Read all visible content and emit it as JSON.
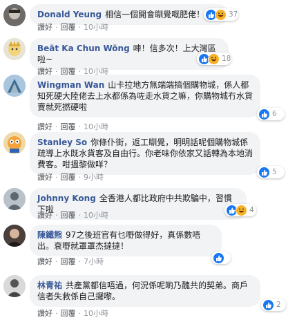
{
  "comments": [
    {
      "author": "Donald Yeung",
      "text": "相信一個開會瞓覺嘅肥佬！",
      "reactions": [
        "like",
        "haha"
      ],
      "reaction_count": "37",
      "like_label": "讚好",
      "reply_label": "回覆",
      "time": "10小時",
      "avatar_icon": "profile-photo-icon"
    },
    {
      "author": "Beät Ka Chun Wöng",
      "text": "唓！信多次！上大灣區啦~",
      "reactions": [
        "like",
        "haha"
      ],
      "reaction_count": "18",
      "like_label": "讚好",
      "reply_label": "回覆",
      "time": "10小時",
      "avatar_icon": "profile-photo-icon"
    },
    {
      "author": "Wingman Wan",
      "text": "山卡拉地方無端端搞個購物城，係人都知死硬大陸佬去上水都係為咗走水貨之嘛，你購物城冇水貨賣就死撚硬啦",
      "reactions": [
        "like"
      ],
      "reaction_count": "6",
      "like_label": "讚好",
      "reply_label": "回覆",
      "time": "10小時",
      "avatar_icon": "profile-photo-icon"
    },
    {
      "author": "Stanley So",
      "text": "你條仆街，返工瞓覺，明明話呢個購物城係疏導上水既水貨客及自由行。你老味你依家又話轉為本地消費客。咁搵黎做咩？",
      "reactions": [
        "like"
      ],
      "reaction_count": "5",
      "like_label": "讚好",
      "reply_label": "回覆",
      "time": "9小時",
      "avatar_icon": "profile-photo-icon"
    },
    {
      "author": "Johnny Kong",
      "text": "全香港人都比政府中共欺騙中，習慣下啦",
      "reactions": [
        "like",
        "haha"
      ],
      "reaction_count": "4",
      "like_label": "讚好",
      "reply_label": "回覆",
      "time": "10小時",
      "avatar_icon": "profile-photo-icon"
    },
    {
      "author": "陳鐵熊",
      "text": "97之後班官有乜嘢做得好，真係數唔出。衰嘢就罩罩杰撻撻！",
      "reactions": [
        "like"
      ],
      "reaction_count": "",
      "like_label": "讚好",
      "reply_label": "回覆",
      "time": "7小時",
      "avatar_icon": "profile-photo-icon"
    },
    {
      "author": "林青祐",
      "text": "共產黨都信唔過，何況係呢啲乃醜共的契弟。商戶信者失救係自己攞嚟。",
      "reactions": [
        "like"
      ],
      "reaction_count": "2",
      "like_label": "讚好",
      "reply_label": "回覆",
      "time": "10小時",
      "avatar_icon": "profile-photo-icon"
    }
  ],
  "colors": {
    "author": "#385898",
    "bubble": "#f2f3f5",
    "meta": "#90949c",
    "like": "#1877f2",
    "haha": "#f7b125"
  }
}
